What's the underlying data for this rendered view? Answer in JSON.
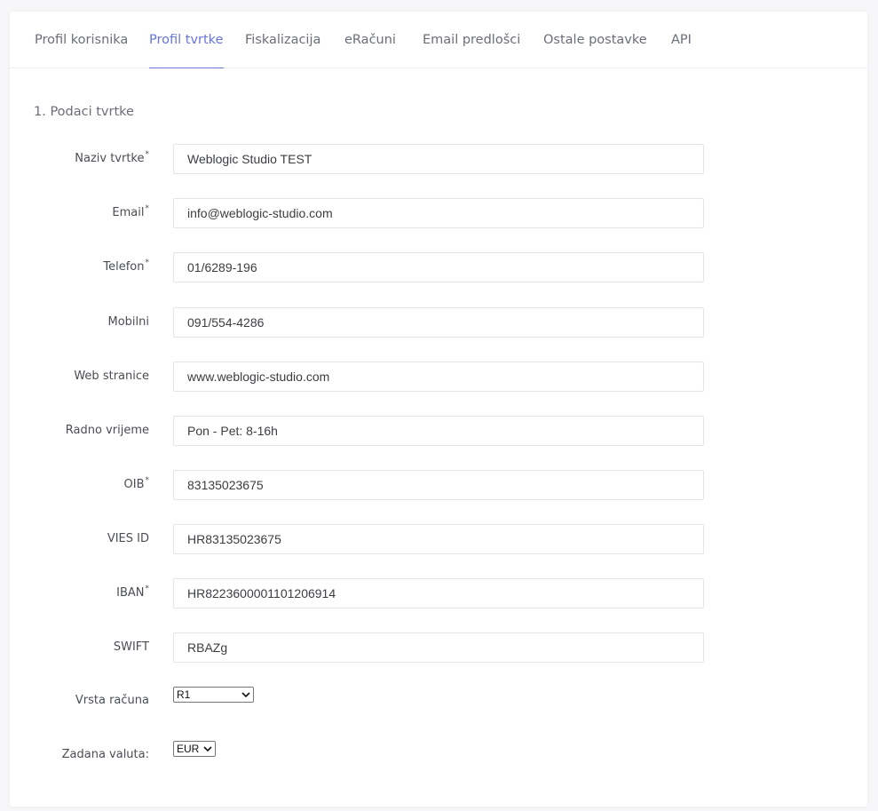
{
  "tabs": [
    {
      "label": "Profil korisnika",
      "active": false
    },
    {
      "label": "Profil tvrtke",
      "active": true
    },
    {
      "label": "Fiskalizacija",
      "active": false
    },
    {
      "label": "eRačuni",
      "active": false
    },
    {
      "label": "Email predlošci",
      "active": false
    },
    {
      "label": "Ostale postavke",
      "active": false
    },
    {
      "label": "API",
      "active": false
    }
  ],
  "section_title": "1. Podaci tvrtke",
  "required_mark": "*",
  "fields": {
    "naziv": {
      "label": "Naziv tvrtke",
      "required": true,
      "value": "Weblogic Studio TEST"
    },
    "email": {
      "label": "Email",
      "required": true,
      "value": "info@weblogic-studio.com"
    },
    "telefon": {
      "label": "Telefon",
      "required": true,
      "value": "01/6289-196"
    },
    "mobilni": {
      "label": "Mobilni",
      "required": false,
      "value": "091/554-4286"
    },
    "web": {
      "label": "Web stranice",
      "required": false,
      "value": "www.weblogic-studio.com"
    },
    "radno_vrijeme": {
      "label": "Radno vrijeme",
      "required": false,
      "value": "Pon - Pet: 8-16h"
    },
    "oib": {
      "label": "OIB",
      "required": true,
      "value": "83135023675"
    },
    "vies": {
      "label": "VIES ID",
      "required": false,
      "value": "HR83135023675"
    },
    "iban": {
      "label": "IBAN",
      "required": true,
      "value": "HR8223600001101206914"
    },
    "swift": {
      "label": "SWIFT",
      "required": false,
      "value": "RBAZg"
    }
  },
  "selects": {
    "vrsta_racuna": {
      "label": "Vrsta računa",
      "value": "R1"
    },
    "valuta": {
      "label": "Zadana valuta:",
      "value": "EUR"
    }
  },
  "colors": {
    "accent": "#6774d9",
    "text": "#4a4d55",
    "muted": "#6b6e78",
    "border": "#e4e5ea"
  }
}
